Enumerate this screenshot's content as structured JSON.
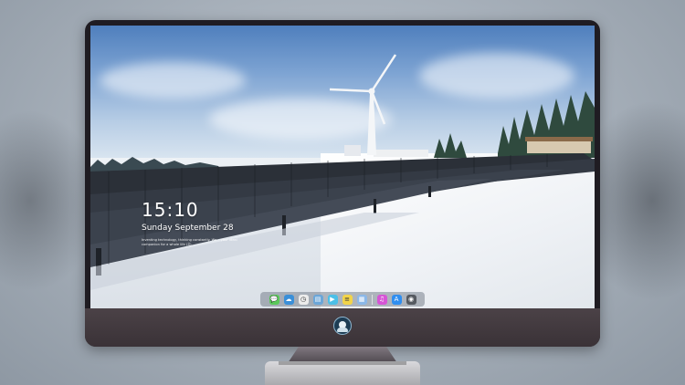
{
  "lockscreen": {
    "time": "15:10",
    "date": "Sunday September 28",
    "tagline": "Inventing technology, thinking constantly. We... your ideal companion for a whole life (ꀾ)"
  },
  "dock": {
    "icons": [
      {
        "name": "messages-icon",
        "color": "#5ac85a",
        "glyph": "💬"
      },
      {
        "name": "weather-icon",
        "color": "#3a8fd8",
        "glyph": "☁"
      },
      {
        "name": "clock-icon",
        "color": "#ececec",
        "glyph": "◷"
      },
      {
        "name": "files-icon",
        "color": "#6ba6d8",
        "glyph": "▤"
      },
      {
        "name": "video-icon",
        "color": "#4cc0e8",
        "glyph": "▶"
      },
      {
        "name": "notes-icon",
        "color": "#f2d44a",
        "glyph": "≡"
      },
      {
        "name": "photos-icon",
        "color": "#8bb8e8",
        "glyph": "▦"
      },
      {
        "name": "music-icon",
        "color": "#d655d6",
        "glyph": "♫"
      },
      {
        "name": "app-store-icon",
        "color": "#2f8ef0",
        "glyph": "A"
      },
      {
        "name": "camera-icon",
        "color": "#555a60",
        "glyph": "◉"
      }
    ]
  },
  "colors": {
    "bezel": "#1f1c22",
    "chin": "#4b4247",
    "sky_top": "#4f7fbd",
    "snow": "#eef2f6"
  }
}
